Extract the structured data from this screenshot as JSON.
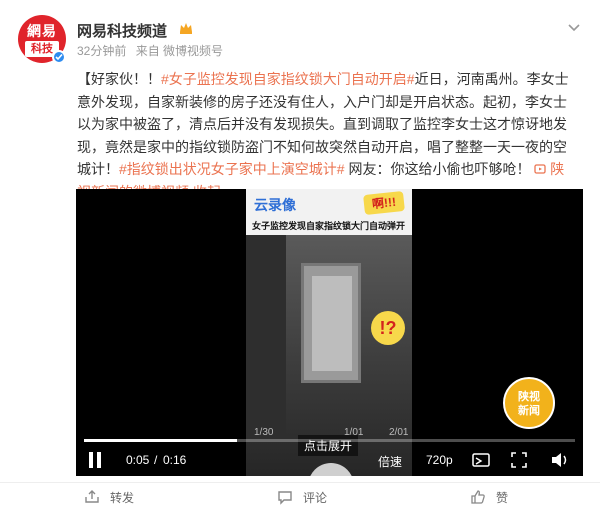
{
  "post": {
    "account_name": "网易科技频道",
    "avatar_line1": "網易",
    "avatar_line2": "科技",
    "time": "32分钟前",
    "source": "来自 微博视频号",
    "text": {
      "p1": "【好家伙！！",
      "tag1": "#女子监控发现自家指纹锁大门自动开启#",
      "p2": "近日，河南禹州。李女士意外发现，自家新装修的房子还没有住人，入户门却是开启状态。起初，李女士以为家中被盗了，清点后并没有发现损失。直到调取了监控李女士这才惊讶地发现，竟然是家中的指纹锁防盗门不知何故突然自动开启，唱了整整一天一夜的空城计！",
      "tag2": "#指纹锁出状况女子家中上演空城计#",
      "p3": "网友：你这给小偷也吓够呛！",
      "video_link": "陕视新闻的微博视频",
      "collapse": "收起"
    }
  },
  "video": {
    "overlay_title": "云录像",
    "overlay_bubble": "啊!!!",
    "overlay_subtitle": "女子监控发现自家指纹锁大门自动弹开",
    "click_expand": "点击展开",
    "alert_mark": "!?",
    "segments": [
      "1/30",
      "1/01",
      "2/01"
    ],
    "badge_line1": "陕视",
    "badge_line2": "新闻",
    "current_time": "0:05",
    "separator": "/",
    "duration": "0:16",
    "progress_fraction": 0.3125,
    "speed_label": "倍速",
    "quality_label": "720p"
  },
  "footer": {
    "repost": "转发",
    "comment": "评论",
    "like": "赞"
  },
  "colors": {
    "link": "#eb7350",
    "accent_red": "#e0242b",
    "verified_blue": "#2d8cf0"
  }
}
